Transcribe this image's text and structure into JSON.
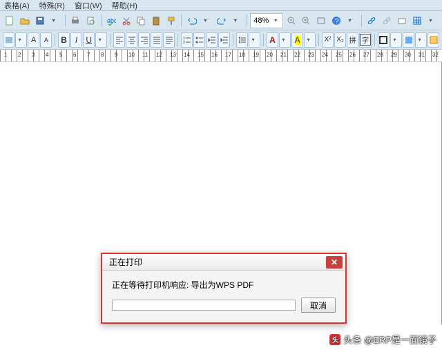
{
  "menu": {
    "items": [
      "表格(A)",
      "特殊(R)",
      "窗口(W)",
      "帮助(H)"
    ]
  },
  "toolbar1": {
    "zoom_value": "48%",
    "icons": [
      "new",
      "open",
      "save",
      "print",
      "preview",
      "spell",
      "cut",
      "copy",
      "paste",
      "fmtpaint",
      "undo",
      "redo"
    ]
  },
  "toolbar2": {},
  "dialog": {
    "title": "正在打印",
    "message": "正在等待打印机响应: 导出为WPS PDF",
    "cancel": "取消"
  },
  "watermark": {
    "text": "头条 @ERP是一面镜子"
  },
  "ruler_numbers": [
    1,
    2,
    3,
    4,
    5,
    6,
    7,
    8,
    9,
    10,
    11,
    12,
    13,
    14,
    15,
    16,
    17,
    18,
    19,
    20,
    21,
    22,
    23,
    24,
    25,
    26,
    27,
    28,
    29,
    30,
    31,
    32
  ]
}
